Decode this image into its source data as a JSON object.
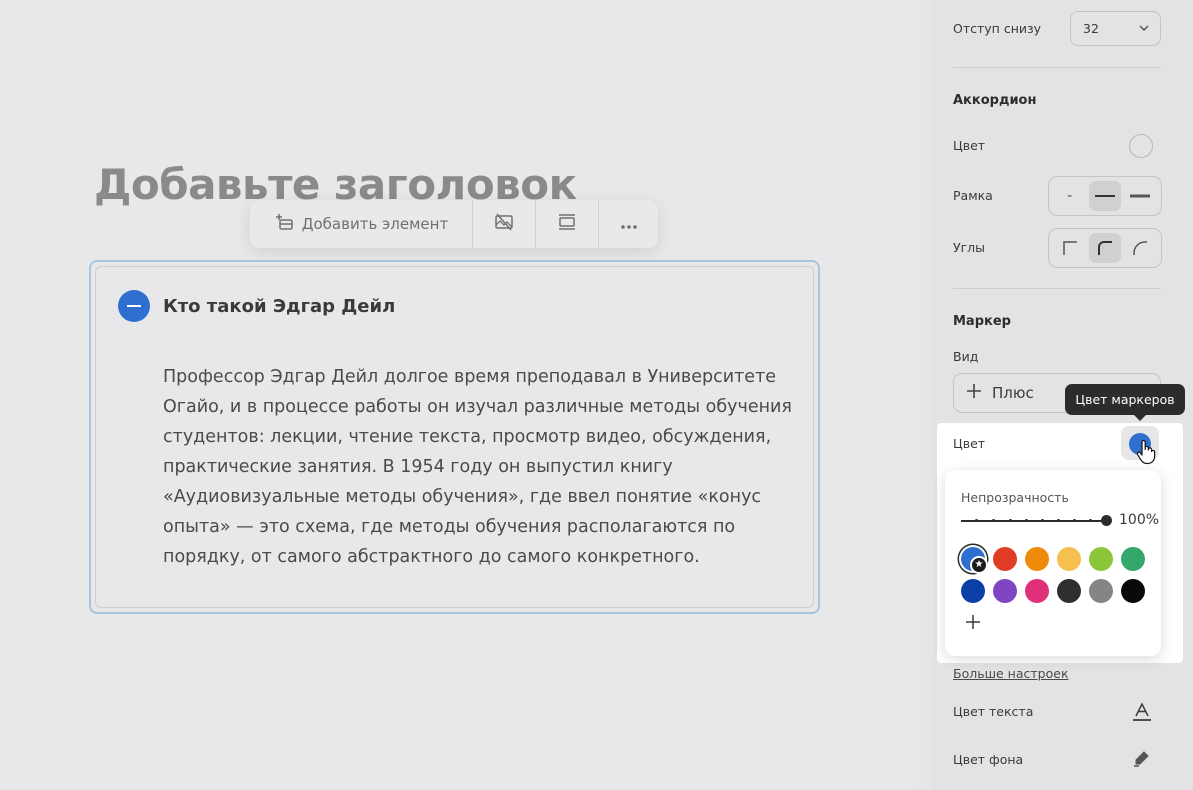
{
  "canvas": {
    "page_title_placeholder": "Добавьте заголовок",
    "toolbar": {
      "add_element_label": "Добавить элемент",
      "icons": [
        "add-block-icon",
        "hide-image-icon",
        "layout-icon",
        "more-icon"
      ]
    },
    "accordion": {
      "title": "Кто такой Эдгар Дейл",
      "body_lines": [
        "Профессор Эдгар Дейл долгое время преподавал в Университете",
        "Огайо, и в процессе работы он изучал различные методы обучения",
        "студентов: лекции, чтение текста, просмотр видео, обсуждения,",
        "практические занятия. В 1954 году он выпустил книгу",
        "«Аудиовизуальные методы обучения», где ввел понятие «конус",
        "опыта» — это схема, где методы обучения располагаются по",
        "порядку, от самого абстрактного до самого конкретного."
      ],
      "marker_color": "#2f6fd0"
    }
  },
  "panel": {
    "bottom_padding": {
      "label": "Отступ снизу",
      "value": "32"
    },
    "accordion_section": {
      "title": "Аккордион",
      "color_label": "Цвет",
      "border_label": "Рамка",
      "border_options": [
        "-",
        "thin-line",
        "thick-line"
      ],
      "border_active": 1,
      "corners_label": "Углы",
      "corners_options": [
        "square",
        "rounded",
        "round"
      ],
      "corners_active": 1
    },
    "marker_section": {
      "title": "Маркер",
      "type_label": "Вид",
      "type_value": "Плюс",
      "color_label": "Цвет",
      "tooltip": "Цвет маркеров",
      "selected_color": "#2f6fd0"
    },
    "color_popup": {
      "opacity_label": "Непрозрачность",
      "opacity_value": "100%",
      "opacity_fraction": 1.0,
      "swatches_row1": [
        "#2f6fd0",
        "#e03b25",
        "#f08a0a",
        "#f5c04e",
        "#8cc63a",
        "#34a86a"
      ],
      "swatches_row2": [
        "#0b3fa8",
        "#8045c2",
        "#e0307a",
        "#2e2f31",
        "#858585",
        "#0a0a0a"
      ],
      "selected_index": 0
    },
    "more_settings_link": "Больше настроек",
    "text_color_label": "Цвет текста",
    "bg_color_label": "Цвет фона"
  }
}
